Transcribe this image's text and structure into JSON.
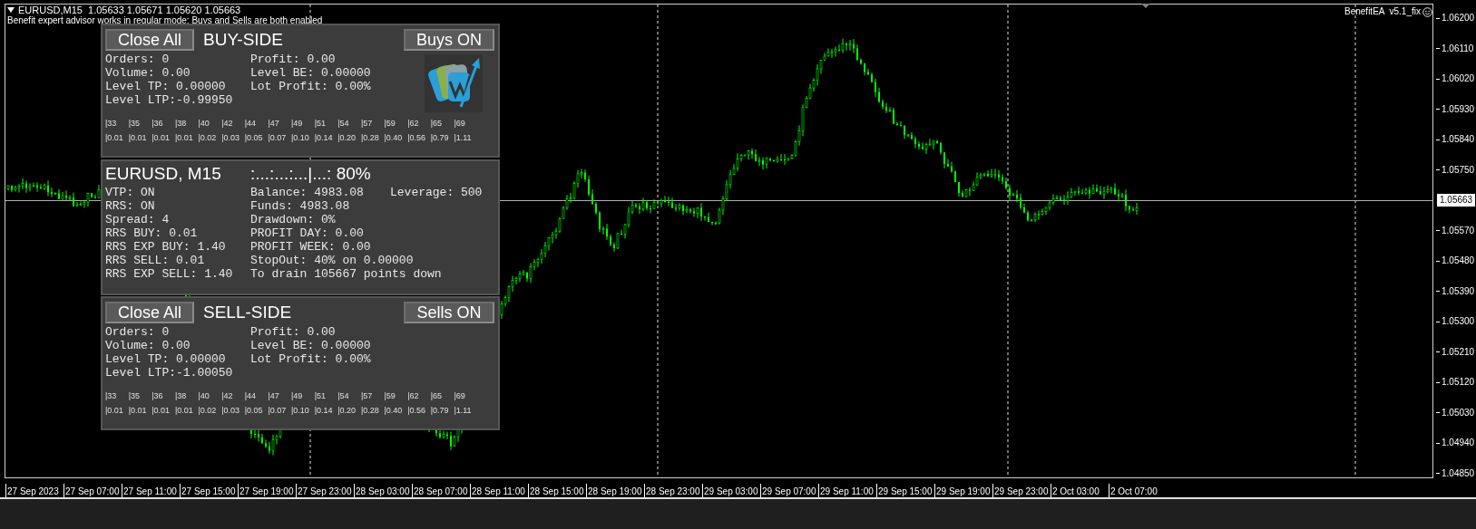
{
  "chart_header": {
    "title": "EURUSD,M15  1.05633 1.05671 1.05620 1.05663",
    "status": "Benefit expert advisor works in regular mode: Buys and Sells are both enabled"
  },
  "ea_label": "BenefitEA  v5.1_fix",
  "buy_panel": {
    "close_button": "Close All",
    "title": "BUY-SIDE",
    "toggle_button": "Buys ON",
    "left_stats": [
      "Orders: 0",
      "Volume: 0.00",
      "Level TP: 0.00000",
      "Level LTP:-0.99950"
    ],
    "right_stats": [
      "Profit: 0.00",
      "Level BE: 0.00000",
      "Lot Profit: 0.00%"
    ],
    "levels": [
      "|33",
      "|35",
      "|36",
      "|38",
      "|40",
      "|42",
      "|44",
      "|47",
      "|49",
      "|51",
      "|54",
      "|57",
      "|59",
      "|62",
      "|65",
      "|69"
    ],
    "lots": [
      "|0.01",
      "|0.01",
      "|0.01",
      "|0.01",
      "|0.02",
      "|0.03",
      "|0.05",
      "|0.07",
      "|0.10",
      "|0.14",
      "|0.20",
      "|0.28",
      "|0.40",
      "|0.56",
      "|0.79",
      "|1.11"
    ]
  },
  "info_panel": {
    "title": "EURUSD, M15",
    "meter": ":...:...:...|...: 80%",
    "left": [
      "VTP: ON",
      "RRS: ON",
      "Spread: 4",
      "RRS BUY: 0.01",
      "RRS EXP BUY: 1.40",
      "RRS SELL: 0.01",
      "RRS EXP SELL: 1.40"
    ],
    "middle": [
      "Balance: 4983.08",
      "Funds: 4983.08",
      "Drawdown: 0%",
      "PROFIT DAY: 0.00",
      "PROFIT WEEK: 0.00",
      "StopOut: 40% on 0.00000",
      "To drain 105667 points down"
    ],
    "right": [
      "Leverage: 500"
    ]
  },
  "sell_panel": {
    "close_button": "Close All",
    "title": "SELL-SIDE",
    "toggle_button": "Sells ON",
    "left_stats": [
      "Orders: 0",
      "Volume: 0.00",
      "Level TP: 0.00000",
      "Level LTP:-1.00050"
    ],
    "right_stats": [
      "Profit: 0.00",
      "Level BE: 0.00000",
      "Lot Profit: 0.00%"
    ],
    "levels": [
      "|33",
      "|35",
      "|36",
      "|38",
      "|40",
      "|42",
      "|44",
      "|47",
      "|49",
      "|51",
      "|54",
      "|57",
      "|59",
      "|62",
      "|65",
      "|69"
    ],
    "lots": [
      "|0.01",
      "|0.01",
      "|0.01",
      "|0.01",
      "|0.02",
      "|0.03",
      "|0.05",
      "|0.07",
      "|0.10",
      "|0.14",
      "|0.20",
      "|0.28",
      "|0.40",
      "|0.56",
      "|0.79",
      "|1.11"
    ]
  },
  "price_axis": {
    "labels": [
      {
        "text": "1.06200",
        "kind": "tick"
      },
      {
        "text": "1.06110",
        "kind": "tick"
      },
      {
        "text": "1.06020",
        "kind": "tick"
      },
      {
        "text": "1.05930",
        "kind": "tick"
      },
      {
        "text": "1.05840",
        "kind": "tick"
      },
      {
        "text": "1.05750",
        "kind": "tick"
      },
      {
        "text": "1.05663",
        "kind": "current"
      },
      {
        "text": "1.05570",
        "kind": "tick"
      },
      {
        "text": "1.05480",
        "kind": "tick"
      },
      {
        "text": "1.05390",
        "kind": "tick"
      },
      {
        "text": "1.05300",
        "kind": "tick"
      },
      {
        "text": "1.05210",
        "kind": "tick"
      },
      {
        "text": "1.05120",
        "kind": "tick"
      },
      {
        "text": "1.05030",
        "kind": "tick"
      },
      {
        "text": "1.04940",
        "kind": "tick"
      },
      {
        "text": "1.04850",
        "kind": "tick"
      }
    ]
  },
  "time_axis": [
    "27 Sep 2023",
    "27 Sep 07:00",
    "27 Sep 11:00",
    "27 Sep 15:00",
    "27 Sep 19:00",
    "27 Sep 23:00",
    "28 Sep 03:00",
    "28 Sep 07:00",
    "28 Sep 11:00",
    "28 Sep 15:00",
    "28 Sep 19:00",
    "28 Sep 23:00",
    "29 Sep 03:00",
    "29 Sep 07:00",
    "29 Sep 11:00",
    "29 Sep 15:00",
    "29 Sep 19:00",
    "29 Sep 23:00",
    "2 Oct 03:00",
    "2 Oct 07:00"
  ]
}
